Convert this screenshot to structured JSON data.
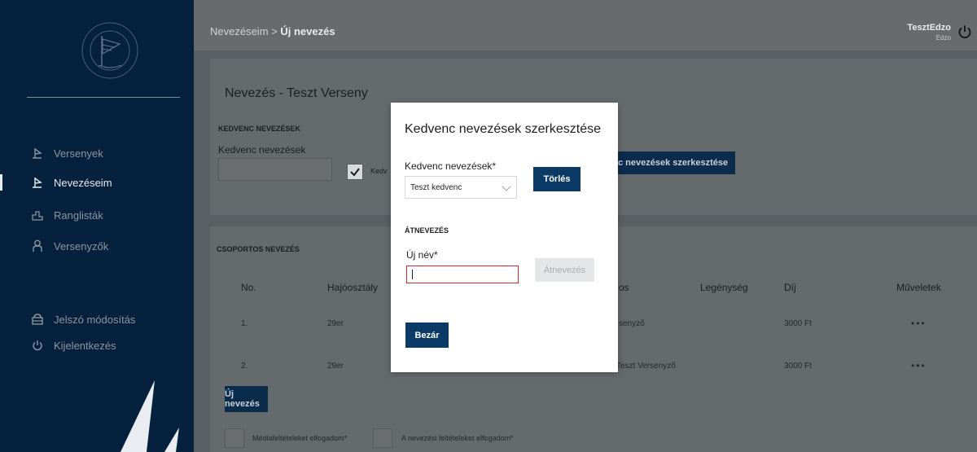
{
  "sidebar": {
    "nav_items": [
      {
        "label": "Versenyek",
        "icon": "sail-flag-icon",
        "active": false
      },
      {
        "label": "Nevezéseim",
        "icon": "sail-flag-icon",
        "active": true
      },
      {
        "label": "Ranglisták",
        "icon": "podium-icon",
        "active": false
      },
      {
        "label": "Versenyzők",
        "icon": "person-icon",
        "active": false
      }
    ],
    "bottom_items": [
      {
        "label": "Jelszó módosítás",
        "icon": "lock-icon"
      },
      {
        "label": "Kijelentkezés",
        "icon": "power-icon"
      }
    ]
  },
  "header": {
    "breadcrumb_parent": "Nevezéseim",
    "breadcrumb_separator": ">",
    "breadcrumb_current": "Új nevezés",
    "user_name": "TesztEdzo",
    "user_role": "Edzo"
  },
  "page": {
    "title": "Nevezés - Teszt Verseny",
    "favorites_section": "KEDVENC NEVEZÉSEK",
    "favorites_label": "Kedvenc nevezések",
    "favorites_checkbox_label": "Kedv",
    "edit_favorites_button": "c nevezések szerkesztése",
    "group_section": "CSOPORTOS NEVEZÉS",
    "table_headers": [
      "No.",
      "Hajóosztály",
      "os",
      "Legénység",
      "Díj",
      "Műveletek"
    ],
    "rows": [
      {
        "no": "1.",
        "class": "29er",
        "owner": "senyző",
        "fee": "3000 Ft",
        "actions": "•••"
      },
      {
        "no": "2.",
        "class": "29er",
        "owner": "Teszt Versenyző",
        "fee": "3000 Ft",
        "actions": "•••"
      }
    ],
    "new_entry_button": "Új nevezés",
    "media_terms": "Médiafeltételeket elfogadom*",
    "entry_terms": "A nevezési feltételeket elfogadom*"
  },
  "modal": {
    "title": "Kedvenc nevezések szerkesztése",
    "select_label": "Kedvenc nevezések*",
    "select_value": "Teszt kedvenc",
    "delete_button": "Törlés",
    "rename_section": "ÁTNEVEZÉS",
    "new_name_label": "Új név*",
    "new_name_value": "",
    "rename_button": "Átnevezés",
    "close_button": "Bezár"
  },
  "colors": {
    "sidebar_bg": "#06213d",
    "primary": "#0c3a67",
    "error": "#d9262b"
  }
}
